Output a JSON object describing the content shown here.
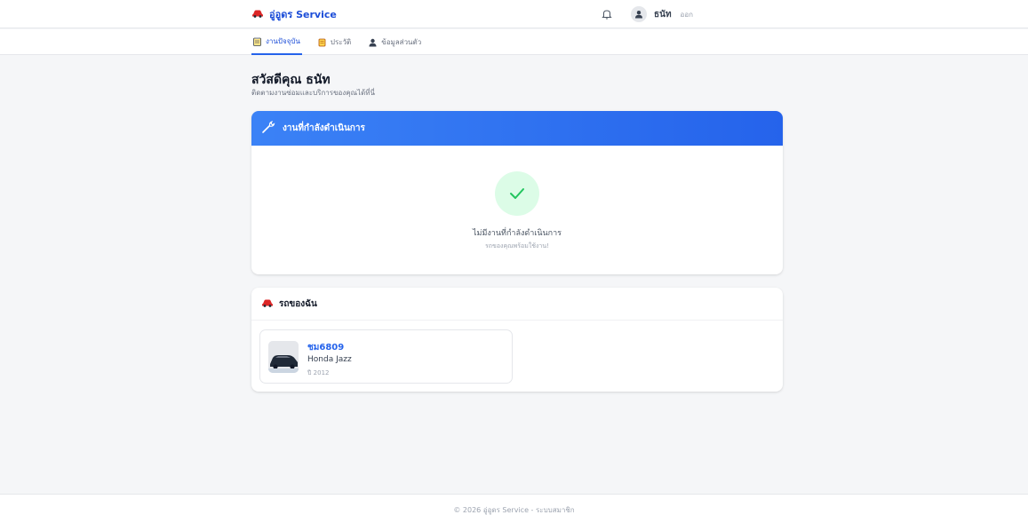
{
  "header": {
    "brand": "อู่อูดร Service",
    "user_name": "ธนัท",
    "logout_label": "ออก"
  },
  "tabs": [
    {
      "label": "งานปัจจุบัน",
      "icon": "clipboard-icon",
      "active": true
    },
    {
      "label": "ประวัติ",
      "icon": "scroll-icon",
      "active": false
    },
    {
      "label": "ข้อมูลส่วนตัว",
      "icon": "user-icon",
      "active": false
    }
  ],
  "greeting": {
    "title": "สวัสดีคุณ ธนัท",
    "subtitle": "ติดตามงานซ่อมและบริการของคุณได้ที่นี่"
  },
  "active_jobs": {
    "title": "งานที่กำลังดำเนินการ",
    "empty_title": "ไม่มีงานที่กำลังดำเนินการ",
    "empty_subtitle": "รถของคุณพร้อมใช้งาน!"
  },
  "my_cars": {
    "title": "รถของฉัน",
    "cars": [
      {
        "plate": "ชม6809",
        "model": "Honda Jazz",
        "year": "ปี 2012"
      }
    ]
  },
  "footer": {
    "text": "© 2026 อู่อูดร Service - ระบบสมาชิก"
  },
  "colors": {
    "accent": "#2563eb",
    "header_gradient_start": "#3b82f6",
    "success_bg": "#dcfce7",
    "success_check": "#22c55e"
  }
}
